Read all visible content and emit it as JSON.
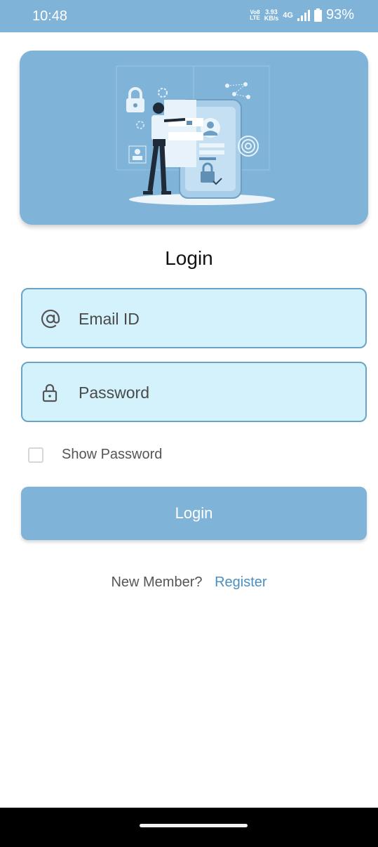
{
  "status_bar": {
    "time": "10:48",
    "volte_top": "Vo8",
    "volte_bottom": "LTE",
    "speed_value": "3.93",
    "speed_unit": "KB/s",
    "network": "4G",
    "battery_percent": "93%"
  },
  "hero": {
    "illustration": "security-login-illustration"
  },
  "login": {
    "title": "Login",
    "email": {
      "placeholder": "Email ID",
      "value": "",
      "icon": "at-icon"
    },
    "password": {
      "placeholder": "Password",
      "value": "",
      "icon": "lock-icon"
    },
    "show_password_label": "Show Password",
    "show_password_checked": false,
    "button_label": "Login",
    "register_question": "New Member?",
    "register_link": "Register"
  },
  "colors": {
    "accent": "#7fb3d8",
    "field_bg": "#d4f2fc",
    "field_border": "#6aa3c5",
    "link": "#4a8fc0"
  }
}
